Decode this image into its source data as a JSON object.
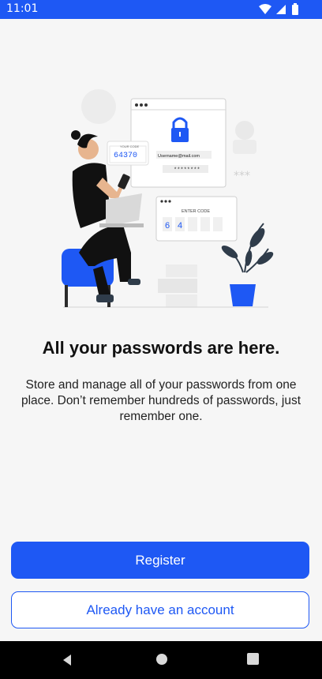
{
  "status_bar": {
    "time": "11:01",
    "icons": [
      "wifi-icon",
      "cellular-icon",
      "battery-icon"
    ]
  },
  "illustration": {
    "description_icon": "password-illustration-icon",
    "otp_card_title": "YOUR CODE",
    "otp_code": "64370",
    "login_email": "Username@mail.com",
    "login_password_mask": "********",
    "enter_code_title": "ENTER CODE",
    "code_digits": [
      "6",
      "4",
      "",
      "",
      ""
    ],
    "masked_stars": "***"
  },
  "onboarding": {
    "headline": "All your passwords are here.",
    "description": "Store and manage all of your passwords from one place. Don’t remember hundreds of passwords, just remember one."
  },
  "actions": {
    "register_label": "Register",
    "login_label": "Already have an account"
  },
  "nav_bar": {
    "icons": [
      "back-icon",
      "home-icon",
      "recents-icon"
    ]
  },
  "colors": {
    "accent": "#1e58f4",
    "background": "#f6f6f6"
  }
}
